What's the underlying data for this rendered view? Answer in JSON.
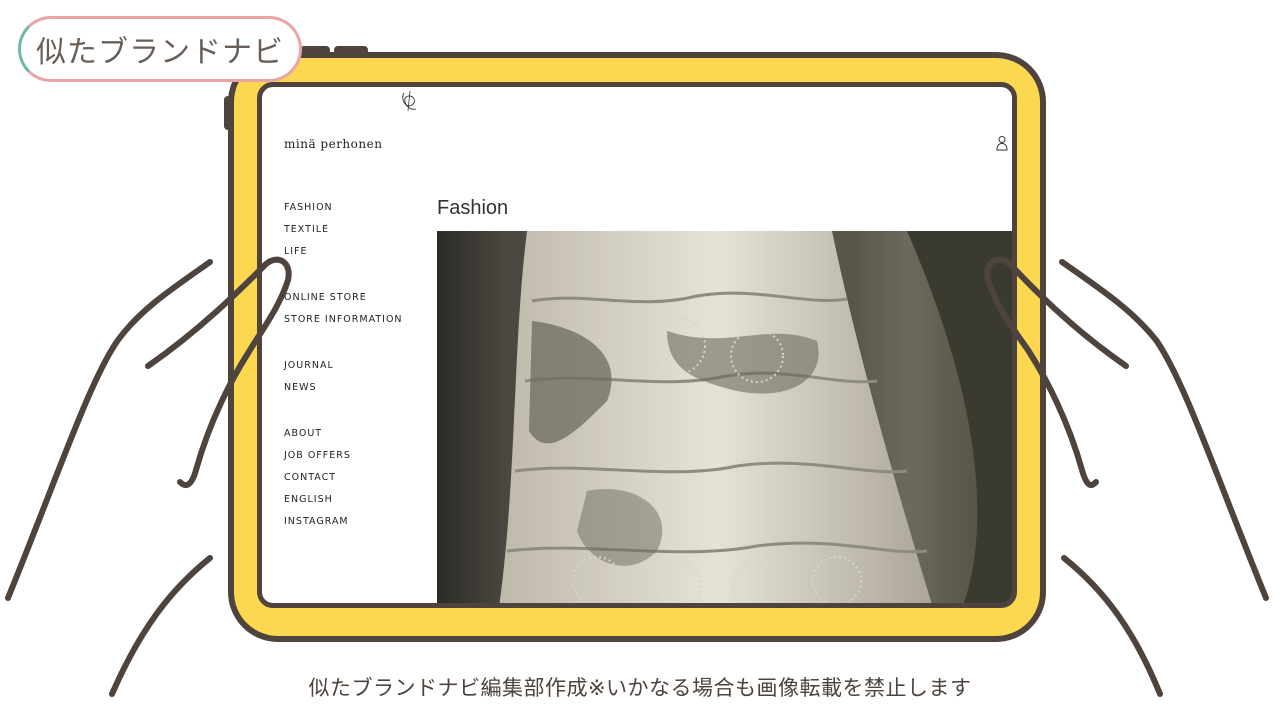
{
  "badge": {
    "label": "似たブランドナビ"
  },
  "site": {
    "logo": "minä perhonen",
    "nav": {
      "group1": [
        "FASHION",
        "TEXTILE",
        "LIFE"
      ],
      "group2": [
        "ONLINE STORE",
        "STORE INFORMATION"
      ],
      "group3": [
        "JOURNAL",
        "NEWS"
      ],
      "group4": [
        "ABOUT",
        "JOB OFFERS",
        "CONTACT",
        "ENGLISH",
        "INSTAGRAM"
      ]
    },
    "page_title": "Fashion"
  },
  "caption": "似たブランドナビ編集部作成※いかなる場合も画像転載を禁止します",
  "colors": {
    "tablet_frame": "#fbd84f",
    "outline": "#4e433d",
    "badge_border_pink": "#e9a5a5",
    "badge_border_green": "#6fb9a0"
  }
}
